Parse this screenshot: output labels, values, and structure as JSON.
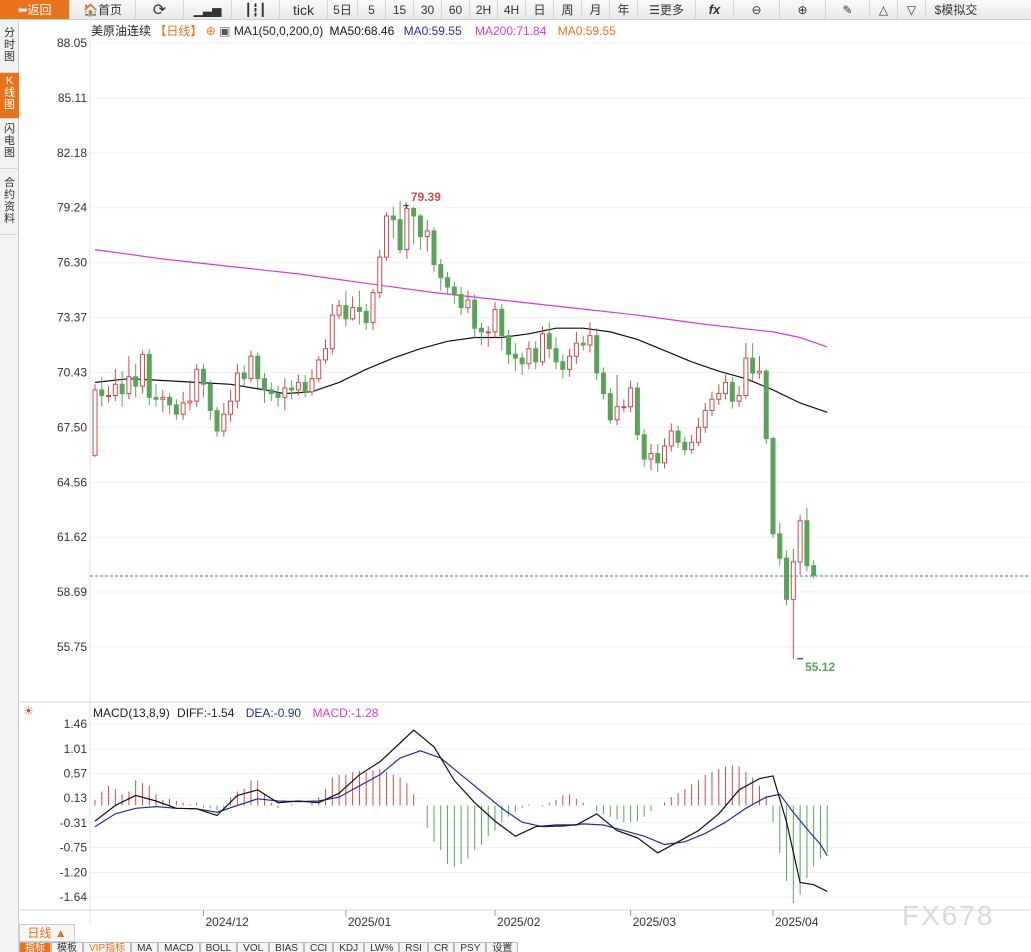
{
  "toolbar": {
    "back": "返回",
    "home": "首页",
    "tick": "tick",
    "periods": [
      "5日",
      "5",
      "15",
      "30",
      "60",
      "2H",
      "4H",
      "日",
      "周",
      "月",
      "年"
    ],
    "more": "更多",
    "fx": "fx",
    "simulate": "模拟交"
  },
  "left_tabs": [
    "分时图",
    "K线图",
    "闪电图",
    "合约资料"
  ],
  "header": {
    "symbol": "美原油连续",
    "period": "【日线】",
    "ma_label": "MA1(50,0,200,0)",
    "ma50": "MA50:68.46",
    "ma0a": "MA0:59.55",
    "ma200": "MA200:71.84",
    "ma0b": "MA0:59.55"
  },
  "macd_header": {
    "name": "MACD(13,8,9)",
    "diff": "DIFF:-1.54",
    "dea": "DEA:-0.90",
    "macd": "MACD:-1.28"
  },
  "period_tab": "日线 ▲",
  "bottom_tabs": [
    "指标",
    "模板",
    "VIP指标",
    "MA",
    "MACD",
    "BOLL",
    "VOL",
    "BIAS",
    "CCI",
    "KDJ",
    "LW%",
    "RSI",
    "CR",
    "PSY",
    "设置"
  ],
  "watermark": "FX678",
  "colors": {
    "up": "#c94c4c",
    "down": "#5aa35a",
    "ma50": "#111111",
    "ma200": "#d63cd6",
    "diff": "#111111",
    "dea": "#1f2f9f",
    "accent": "#e8731c"
  },
  "chart_data": {
    "type": "candlestick",
    "y_ticks": [
      "88.05",
      "85.11",
      "82.18",
      "79.24",
      "76.30",
      "73.37",
      "70.43",
      "67.50",
      "64.56",
      "61.62",
      "58.69",
      "55.75"
    ],
    "ylim": [
      54.0,
      88.5
    ],
    "x_ticks": [
      {
        "label": "2024/12",
        "index": 16
      },
      {
        "label": "2025/01",
        "index": 37
      },
      {
        "label": "2025/02",
        "index": 59
      },
      {
        "label": "2025/03",
        "index": 79
      },
      {
        "label": "2025/04",
        "index": 100
      }
    ],
    "candles": [
      [
        66.0,
        69.5,
        69.8,
        65.9
      ],
      [
        69.5,
        69.2,
        70.2,
        68.6
      ],
      [
        69.2,
        69.2,
        69.7,
        68.8
      ],
      [
        69.2,
        69.8,
        70.6,
        68.9
      ],
      [
        69.8,
        69.3,
        70.5,
        68.6
      ],
      [
        69.3,
        70.2,
        71.3,
        69.0
      ],
      [
        70.2,
        69.7,
        70.9,
        69.1
      ],
      [
        69.7,
        71.4,
        71.6,
        69.3
      ],
      [
        71.4,
        69.1,
        71.7,
        68.7
      ],
      [
        69.1,
        69.0,
        69.8,
        68.6
      ],
      [
        69.0,
        69.1,
        69.5,
        68.3
      ],
      [
        69.1,
        68.7,
        69.3,
        68.2
      ],
      [
        68.7,
        68.2,
        69.0,
        67.9
      ],
      [
        68.2,
        68.8,
        69.4,
        67.9
      ],
      [
        68.8,
        68.9,
        70.0,
        68.4
      ],
      [
        68.9,
        70.6,
        70.9,
        68.6
      ],
      [
        70.6,
        69.8,
        70.9,
        69.1
      ],
      [
        69.8,
        68.4,
        70.0,
        67.9
      ],
      [
        68.4,
        67.3,
        68.6,
        67.0
      ],
      [
        67.3,
        68.2,
        68.8,
        67.0
      ],
      [
        68.2,
        68.9,
        69.5,
        67.8
      ],
      [
        68.9,
        70.4,
        70.9,
        68.5
      ],
      [
        70.4,
        70.1,
        70.8,
        69.7
      ],
      [
        70.1,
        71.3,
        71.6,
        69.9
      ],
      [
        71.3,
        70.1,
        71.5,
        69.6
      ],
      [
        70.1,
        69.5,
        70.4,
        68.8
      ],
      [
        69.5,
        69.3,
        69.9,
        68.9
      ],
      [
        69.3,
        69.1,
        69.7,
        68.6
      ],
      [
        69.1,
        69.6,
        70.1,
        68.4
      ],
      [
        69.6,
        69.5,
        70.0,
        69.0
      ],
      [
        69.5,
        69.9,
        70.3,
        69.2
      ],
      [
        69.9,
        69.4,
        70.3,
        69.1
      ],
      [
        69.4,
        70.1,
        70.6,
        69.2
      ],
      [
        70.1,
        71.1,
        71.3,
        69.9
      ],
      [
        71.1,
        71.7,
        72.2,
        70.9
      ],
      [
        71.7,
        73.5,
        74.1,
        71.4
      ],
      [
        73.5,
        74.0,
        74.3,
        73.3
      ],
      [
        74.0,
        73.3,
        74.8,
        72.9
      ],
      [
        73.3,
        73.9,
        74.5,
        73.2
      ],
      [
        73.9,
        73.7,
        74.8,
        73.0
      ],
      [
        73.7,
        73.1,
        74.1,
        72.7
      ],
      [
        73.1,
        74.7,
        74.9,
        72.7
      ],
      [
        74.7,
        76.6,
        77.0,
        74.4
      ],
      [
        76.6,
        78.8,
        79.0,
        76.4
      ],
      [
        78.8,
        78.6,
        79.3,
        77.6
      ],
      [
        78.6,
        77.0,
        79.6,
        76.8
      ],
      [
        77.0,
        79.2,
        79.39,
        76.5
      ],
      [
        79.2,
        78.8,
        79.3,
        77.3
      ],
      [
        78.8,
        77.7,
        78.9,
        77.0
      ],
      [
        77.7,
        78.0,
        78.6,
        76.9
      ],
      [
        78.0,
        76.2,
        78.2,
        75.8
      ],
      [
        76.2,
        75.5,
        76.5,
        74.8
      ],
      [
        75.5,
        75.0,
        75.8,
        74.6
      ],
      [
        75.0,
        74.6,
        75.3,
        74.1
      ],
      [
        74.6,
        73.9,
        75.0,
        73.5
      ],
      [
        73.9,
        74.3,
        74.8,
        73.6
      ],
      [
        74.3,
        72.8,
        74.6,
        72.3
      ],
      [
        72.8,
        72.6,
        73.1,
        71.9
      ],
      [
        72.6,
        72.6,
        72.9,
        71.8
      ],
      [
        72.6,
        73.8,
        74.2,
        72.3
      ],
      [
        73.8,
        72.4,
        74.1,
        71.6
      ],
      [
        72.4,
        71.4,
        72.7,
        70.9
      ],
      [
        71.4,
        71.2,
        72.0,
        70.5
      ],
      [
        71.2,
        70.9,
        71.5,
        70.3
      ],
      [
        70.9,
        71.7,
        72.1,
        70.6
      ],
      [
        71.7,
        71.0,
        72.1,
        70.6
      ],
      [
        71.0,
        72.5,
        72.9,
        70.8
      ],
      [
        72.5,
        71.7,
        73.1,
        71.2
      ],
      [
        71.7,
        71.0,
        72.3,
        70.6
      ],
      [
        71.0,
        70.6,
        71.4,
        70.1
      ],
      [
        70.6,
        71.3,
        71.7,
        70.2
      ],
      [
        71.3,
        72.0,
        72.6,
        70.9
      ],
      [
        72.0,
        71.9,
        72.4,
        71.6
      ],
      [
        71.9,
        72.4,
        73.1,
        71.5
      ],
      [
        72.4,
        70.4,
        72.8,
        70.0
      ],
      [
        70.4,
        69.3,
        70.7,
        69.0
      ],
      [
        69.3,
        67.9,
        69.6,
        67.7
      ],
      [
        67.9,
        68.6,
        70.3,
        67.6
      ],
      [
        68.6,
        68.6,
        69.0,
        68.3
      ],
      [
        68.6,
        69.6,
        70.0,
        68.3
      ],
      [
        69.6,
        67.1,
        69.9,
        66.8
      ],
      [
        67.1,
        65.8,
        67.4,
        65.4
      ],
      [
        65.8,
        66.1,
        66.6,
        65.2
      ],
      [
        66.1,
        65.6,
        66.6,
        65.1
      ],
      [
        65.6,
        66.5,
        66.9,
        65.3
      ],
      [
        66.5,
        67.3,
        67.7,
        66.2
      ],
      [
        67.3,
        66.7,
        67.6,
        66.4
      ],
      [
        66.7,
        66.3,
        67.0,
        66.0
      ],
      [
        66.3,
        66.7,
        67.1,
        66.1
      ],
      [
        66.7,
        67.5,
        68.0,
        66.5
      ],
      [
        67.5,
        68.4,
        68.8,
        67.2
      ],
      [
        68.4,
        69.0,
        69.4,
        68.1
      ],
      [
        69.0,
        69.3,
        69.8,
        68.7
      ],
      [
        69.3,
        69.9,
        70.3,
        69.0
      ],
      [
        69.9,
        68.9,
        70.2,
        68.5
      ],
      [
        68.9,
        69.2,
        69.7,
        68.6
      ],
      [
        69.2,
        71.2,
        72.0,
        69.0
      ],
      [
        71.2,
        70.4,
        72.0,
        70.0
      ],
      [
        70.4,
        70.5,
        71.3,
        70.1
      ],
      [
        70.5,
        66.9,
        70.6,
        66.6
      ],
      [
        66.9,
        61.8,
        67.0,
        61.6
      ],
      [
        61.8,
        60.5,
        62.4,
        60.1
      ],
      [
        60.5,
        58.3,
        60.9,
        58.0
      ],
      [
        58.3,
        60.3,
        61.0,
        55.12
      ],
      [
        60.3,
        62.5,
        62.8,
        59.6
      ],
      [
        62.5,
        60.1,
        63.2,
        59.8
      ],
      [
        60.1,
        59.6,
        60.4,
        59.4
      ]
    ],
    "ma50": [
      [
        0,
        69.9
      ],
      [
        5,
        70.1
      ],
      [
        10,
        70.0
      ],
      [
        15,
        69.9
      ],
      [
        20,
        69.8
      ],
      [
        25,
        69.5
      ],
      [
        28,
        69.3
      ],
      [
        32,
        69.4
      ],
      [
        36,
        69.9
      ],
      [
        40,
        70.6
      ],
      [
        44,
        71.2
      ],
      [
        48,
        71.7
      ],
      [
        52,
        72.1
      ],
      [
        56,
        72.3
      ],
      [
        60,
        72.3
      ],
      [
        64,
        72.5
      ],
      [
        68,
        72.8
      ],
      [
        72,
        72.8
      ],
      [
        76,
        72.6
      ],
      [
        80,
        72.2
      ],
      [
        84,
        71.6
      ],
      [
        88,
        71.0
      ],
      [
        92,
        70.5
      ],
      [
        96,
        70.1
      ],
      [
        100,
        69.5
      ],
      [
        104,
        68.8
      ],
      [
        108,
        68.3
      ]
    ],
    "ma200": [
      [
        0,
        77.0
      ],
      [
        10,
        76.5
      ],
      [
        20,
        76.1
      ],
      [
        30,
        75.7
      ],
      [
        40,
        75.2
      ],
      [
        50,
        74.7
      ],
      [
        60,
        74.3
      ],
      [
        70,
        73.9
      ],
      [
        80,
        73.5
      ],
      [
        90,
        73.0
      ],
      [
        100,
        72.6
      ],
      [
        104,
        72.3
      ],
      [
        108,
        71.8
      ]
    ],
    "macd": {
      "y_ticks": [
        "1.46",
        "1.01",
        "0.57",
        "0.13",
        "-0.31",
        "-0.75",
        "-1.20",
        "-1.64"
      ],
      "ylim": [
        -1.95,
        1.6
      ],
      "diff": [
        [
          0,
          -0.28
        ],
        [
          3,
          0.0
        ],
        [
          6,
          0.18
        ],
        [
          9,
          0.08
        ],
        [
          12,
          -0.05
        ],
        [
          15,
          -0.06
        ],
        [
          18,
          -0.18
        ],
        [
          21,
          0.18
        ],
        [
          24,
          0.28
        ],
        [
          27,
          0.05
        ],
        [
          30,
          0.08
        ],
        [
          33,
          0.05
        ],
        [
          36,
          0.22
        ],
        [
          39,
          0.55
        ],
        [
          42,
          0.78
        ],
        [
          45,
          1.12
        ],
        [
          47,
          1.35
        ],
        [
          50,
          1.05
        ],
        [
          53,
          0.45
        ],
        [
          56,
          0.05
        ],
        [
          59,
          -0.28
        ],
        [
          62,
          -0.55
        ],
        [
          65,
          -0.38
        ],
        [
          68,
          -0.35
        ],
        [
          71,
          -0.35
        ],
        [
          74,
          -0.15
        ],
        [
          77,
          -0.45
        ],
        [
          80,
          -0.58
        ],
        [
          83,
          -0.85
        ],
        [
          86,
          -0.65
        ],
        [
          89,
          -0.45
        ],
        [
          92,
          -0.15
        ],
        [
          95,
          0.28
        ],
        [
          98,
          0.48
        ],
        [
          100,
          0.53
        ],
        [
          102,
          -0.3
        ],
        [
          104,
          -1.38
        ],
        [
          106,
          -1.42
        ],
        [
          108,
          -1.54
        ]
      ],
      "dea": [
        [
          0,
          -0.38
        ],
        [
          3,
          -0.15
        ],
        [
          6,
          -0.05
        ],
        [
          9,
          -0.02
        ],
        [
          12,
          -0.05
        ],
        [
          15,
          -0.06
        ],
        [
          18,
          -0.12
        ],
        [
          21,
          0.0
        ],
        [
          24,
          0.12
        ],
        [
          27,
          0.08
        ],
        [
          30,
          0.07
        ],
        [
          33,
          0.08
        ],
        [
          36,
          0.15
        ],
        [
          39,
          0.35
        ],
        [
          42,
          0.55
        ],
        [
          45,
          0.85
        ],
        [
          48,
          0.98
        ],
        [
          51,
          0.85
        ],
        [
          54,
          0.55
        ],
        [
          57,
          0.25
        ],
        [
          60,
          -0.05
        ],
        [
          63,
          -0.3
        ],
        [
          66,
          -0.38
        ],
        [
          69,
          -0.37
        ],
        [
          72,
          -0.33
        ],
        [
          75,
          -0.35
        ],
        [
          78,
          -0.45
        ],
        [
          81,
          -0.55
        ],
        [
          84,
          -0.7
        ],
        [
          87,
          -0.65
        ],
        [
          90,
          -0.5
        ],
        [
          93,
          -0.3
        ],
        [
          96,
          -0.05
        ],
        [
          99,
          0.15
        ],
        [
          101,
          0.2
        ],
        [
          103,
          -0.12
        ],
        [
          105,
          -0.42
        ],
        [
          107,
          -0.7
        ],
        [
          108,
          -0.9
        ]
      ],
      "hist": [
        0.1,
        0.25,
        0.35,
        0.3,
        0.2,
        0.25,
        0.45,
        0.4,
        0.35,
        0.2,
        0.1,
        0.12,
        0.08,
        0.05,
        0.02,
        0.05,
        -0.04,
        -0.05,
        -0.08,
        -0.1,
        0.15,
        0.25,
        0.3,
        0.45,
        0.45,
        0.2,
        0.05,
        -0.05,
        0.0,
        0.02,
        0.0,
        0.0,
        0.05,
        0.15,
        0.3,
        0.5,
        0.55,
        0.55,
        0.6,
        0.62,
        0.6,
        0.62,
        0.65,
        0.6,
        0.55,
        0.5,
        0.4,
        0.2,
        0.0,
        -0.4,
        -0.65,
        -0.8,
        -1.05,
        -1.1,
        -1.05,
        -0.95,
        -0.8,
        -0.7,
        -0.55,
        -0.45,
        -0.3,
        -0.2,
        -0.12,
        -0.05,
        0.02,
        0.0,
        -0.02,
        0.05,
        0.1,
        0.18,
        0.2,
        0.12,
        0.05,
        0.0,
        -0.1,
        -0.15,
        -0.2,
        -0.25,
        -0.3,
        -0.3,
        -0.28,
        -0.2,
        -0.1,
        0.0,
        0.05,
        0.15,
        0.22,
        0.3,
        0.38,
        0.45,
        0.55,
        0.6,
        0.65,
        0.7,
        0.72,
        0.7,
        0.6,
        0.5,
        0.35,
        0.15,
        -0.3,
        -0.85,
        -1.35,
        -1.75,
        -1.6,
        -1.3,
        -1.1,
        -0.95,
        -0.85
      ]
    },
    "last_price_line": 59.55,
    "high_annotation": {
      "value": "79.39",
      "index": 46
    },
    "low_annotation": {
      "value": "55.12",
      "index": 104
    }
  }
}
